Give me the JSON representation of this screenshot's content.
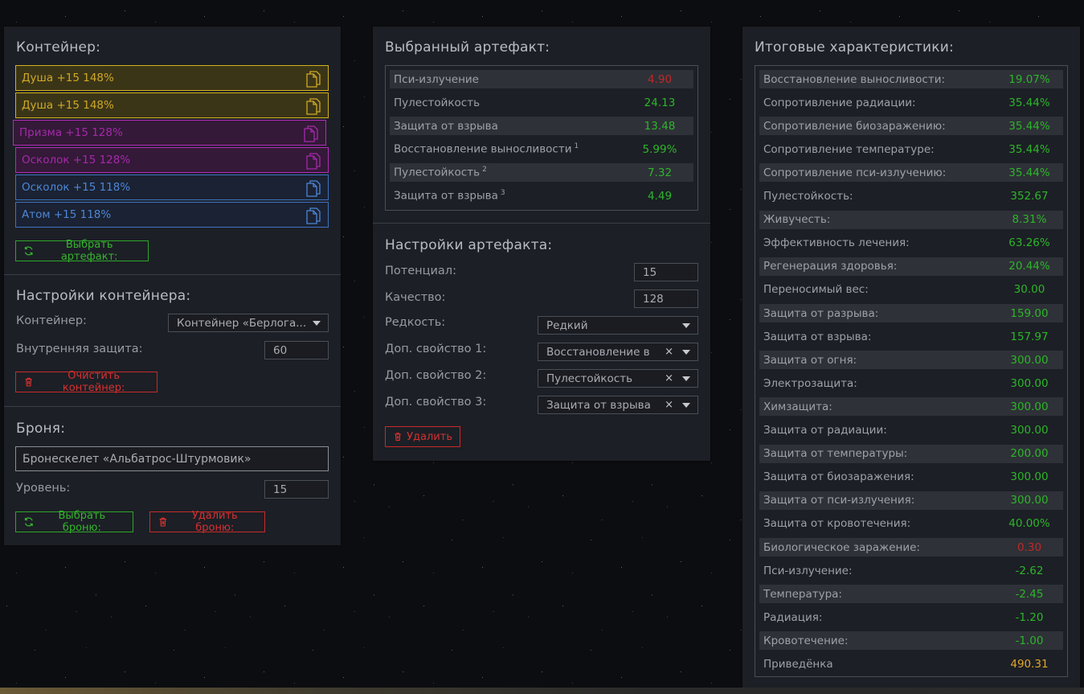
{
  "container_panel": {
    "title": "Контейнер:",
    "slots": [
      {
        "label": "Душа +15 148%",
        "color": "yellow"
      },
      {
        "label": "Душа +15 148%",
        "color": "yellow"
      },
      {
        "label": "Призма +15 128%",
        "color": "magenta"
      },
      {
        "label": "Осколок +15 128%",
        "color": "magenta"
      },
      {
        "label": "Осколок +15 118%",
        "color": "blue"
      },
      {
        "label": "Атом +15 118%",
        "color": "blue"
      }
    ],
    "select_artifact_label": "Выбрать артефакт:",
    "settings_title": "Настройки контейнера:",
    "container_label": "Контейнер:",
    "container_value": "Контейнер «Берлога...",
    "inner_protection_label": "Внутренняя защита:",
    "inner_protection_value": "60",
    "clear_label": "Очистить контейнер:",
    "armor_title": "Броня:",
    "armor_value": "Бронескелет «Альбатрос-Штурмовик»",
    "level_label": "Уровень:",
    "level_value": "15",
    "select_armor_label": "Выбрать броню:",
    "delete_armor_label": "Удалить броню:"
  },
  "artifact_panel": {
    "title": "Выбранный артефакт:",
    "stats": [
      {
        "label": "Пси-излучение",
        "sup": "",
        "value": "4.90",
        "color": "red"
      },
      {
        "label": "Пулестойкость",
        "sup": "",
        "value": "24.13",
        "color": "green"
      },
      {
        "label": "Защита от взрыва",
        "sup": "",
        "value": "13.48",
        "color": "green"
      },
      {
        "label": "Восстановление выносливости",
        "sup": "1",
        "value": "5.99%",
        "color": "green"
      },
      {
        "label": "Пулестойкость",
        "sup": "2",
        "value": "7.32",
        "color": "green"
      },
      {
        "label": "Защита от взрыва",
        "sup": "3",
        "value": "4.49",
        "color": "green"
      }
    ],
    "settings_title": "Настройки артефакта:",
    "potential_label": "Потенциал:",
    "potential_value": "15",
    "quality_label": "Качество:",
    "quality_value": "128",
    "rarity_label": "Редкость:",
    "rarity_value": "Редкий",
    "prop1_label": "Доп. свойство 1:",
    "prop1_value": "Восстановление в",
    "prop2_label": "Доп. свойство 2:",
    "prop2_value": "Пулестойкость",
    "prop3_label": "Доп. свойство 3:",
    "prop3_value": "Защита от взрыва",
    "clear_symbol": "×",
    "delete_label": "Удалить"
  },
  "totals_panel": {
    "title": "Итоговые характеристики:",
    "stats": [
      {
        "label": "Восстановление выносливости:",
        "value": "19.07%",
        "color": "green"
      },
      {
        "label": "Сопротивление радиации:",
        "value": "35.44%",
        "color": "green"
      },
      {
        "label": "Сопротивление биозаражению:",
        "value": "35.44%",
        "color": "green"
      },
      {
        "label": "Сопротивление температуре:",
        "value": "35.44%",
        "color": "green"
      },
      {
        "label": "Сопротивление пси-излучению:",
        "value": "35.44%",
        "color": "green"
      },
      {
        "label": "Пулестойкость:",
        "value": "352.67",
        "color": "green"
      },
      {
        "label": "Живучесть:",
        "value": "8.31%",
        "color": "green"
      },
      {
        "label": "Эффективность лечения:",
        "value": "63.26%",
        "color": "green"
      },
      {
        "label": "Регенерация здоровья:",
        "value": "20.44%",
        "color": "green"
      },
      {
        "label": "Переносимый вес:",
        "value": "30.00",
        "color": "green"
      },
      {
        "label": "Защита от разрыва:",
        "value": "159.00",
        "color": "green"
      },
      {
        "label": "Защита от взрыва:",
        "value": "157.97",
        "color": "green"
      },
      {
        "label": "Защита от огня:",
        "value": "300.00",
        "color": "green"
      },
      {
        "label": "Электрозащита:",
        "value": "300.00",
        "color": "green"
      },
      {
        "label": "Химзащита:",
        "value": "300.00",
        "color": "green"
      },
      {
        "label": "Защита от радиации:",
        "value": "300.00",
        "color": "green"
      },
      {
        "label": "Защита от температуры:",
        "value": "200.00",
        "color": "green"
      },
      {
        "label": "Защита от биозаражения:",
        "value": "300.00",
        "color": "green"
      },
      {
        "label": "Защита от пси-излучения:",
        "value": "300.00",
        "color": "green"
      },
      {
        "label": "Защита от кровотечения:",
        "value": "40.00%",
        "color": "green"
      },
      {
        "label": "Биологическое заражение:",
        "value": "0.30",
        "color": "red"
      },
      {
        "label": "Пси-излучение:",
        "value": "-2.62",
        "color": "green"
      },
      {
        "label": "Температура:",
        "value": "-2.45",
        "color": "green"
      },
      {
        "label": "Радиация:",
        "value": "-1.20",
        "color": "green"
      },
      {
        "label": "Кровотечение:",
        "value": "-1.00",
        "color": "green"
      },
      {
        "label": "Приведёнка",
        "value": "490.31",
        "color": "orange"
      }
    ]
  },
  "colors": {
    "accent_green": "#2db52a",
    "accent_red": "#c82a2a",
    "highlight_orange": "#e2a62a",
    "panel_bg": "#1c1f25"
  }
}
